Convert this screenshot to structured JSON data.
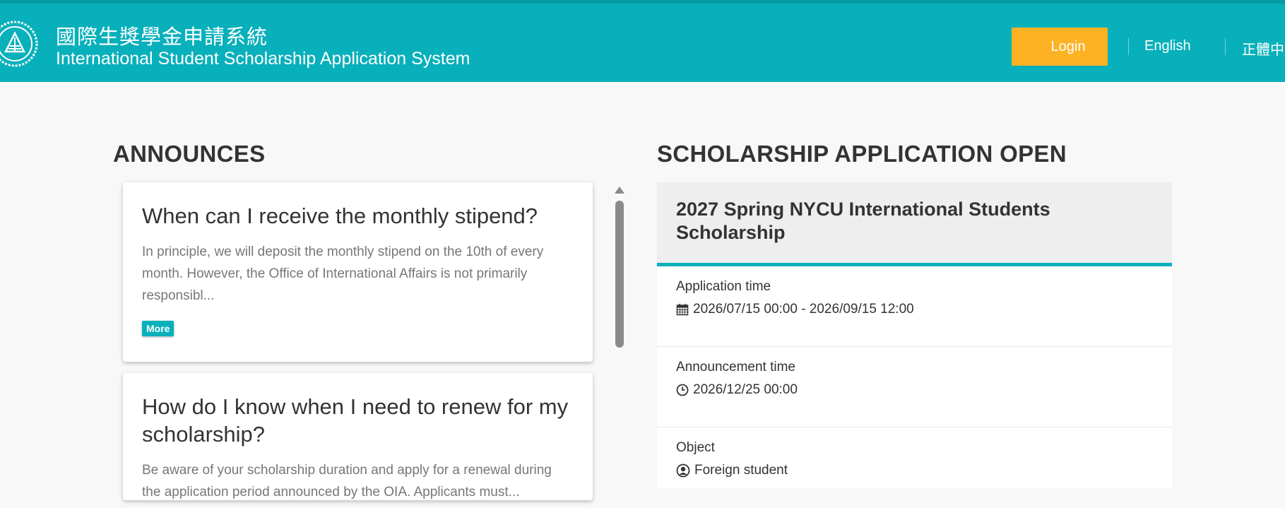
{
  "header": {
    "title_zh": "國際生獎學金申請系統",
    "title_en": "International Student Scholarship Application System",
    "login_label": "Login",
    "lang_en": "English",
    "lang_zh": "正體中文",
    "brand_color": "#08b0bb",
    "login_color": "#fdb224",
    "logo_icon": "university-seal-icon"
  },
  "announces": {
    "heading": "ANNOUNCES",
    "items": [
      {
        "title": "When can I receive the monthly stipend?",
        "text": "In principle, we will deposit the monthly stipend on the 10th of every month. However, the Office of International Affairs is not primarily responsibl...",
        "more_label": "More"
      },
      {
        "title": "How do I know when I need to renew for my scholarship?",
        "text": "Be aware of your scholarship duration and apply for a renewal during the application period announced by the OIA. Applicants must..."
      }
    ]
  },
  "scholarship": {
    "heading": "SCHOLARSHIP APPLICATION OPEN",
    "name": "2027 Spring NYCU International Students Scholarship",
    "rows": [
      {
        "label": "Application time",
        "value": "2026/07/15 00:00 - 2026/09/15 12:00",
        "icon": "calendar-icon"
      },
      {
        "label": "Announcement time",
        "value": "2026/12/25 00:00",
        "icon": "clock-icon"
      },
      {
        "label": "Object",
        "value": "Foreign student",
        "icon": "user-circle-icon"
      }
    ]
  }
}
